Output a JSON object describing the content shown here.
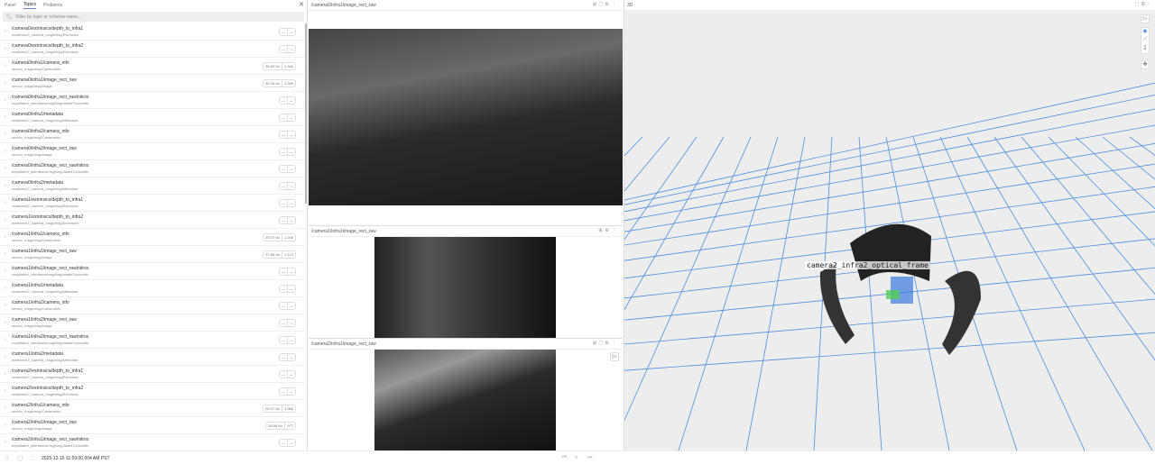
{
  "sidebar": {
    "tabs": [
      "Panel",
      "Topics",
      "Problems"
    ],
    "active_tab": "Topics",
    "search_placeholder": "Filter by topic or schema name...",
    "topics": [
      {
        "name": "/camera0/extrinsics/depth_to_infra1",
        "schema": "realsense2_camera_msgs/msg/Extrinsics",
        "hz": "—",
        "count": "—"
      },
      {
        "name": "/camera0/extrinsics/depth_to_infra2",
        "schema": "realsense2_camera_msgs/msg/Extrinsics",
        "hz": "—",
        "count": "—"
      },
      {
        "name": "/camera0/infra1/camera_info",
        "schema": "sensor_msgs/msg/CameraInfo",
        "hz": "38.89 Hz",
        "count": "1,346"
      },
      {
        "name": "/camera0/infra1/image_rect_raw",
        "schema": "sensor_msgs/msg/Image",
        "hz": "38.36 Hz",
        "count": "1,285"
      },
      {
        "name": "/camera0/infra1/image_rect_raw/nitros",
        "schema": "negotiated_interfaces/msg/NegotiatedTopicsInfo",
        "hz": "—",
        "count": "—"
      },
      {
        "name": "/camera0/infra1/metadata",
        "schema": "realsense2_camera_msgs/msg/Metadata",
        "hz": "—",
        "count": "—"
      },
      {
        "name": "/camera0/infra2/camera_info",
        "schema": "sensor_msgs/msg/CameraInfo",
        "hz": "—",
        "count": "—"
      },
      {
        "name": "/camera0/infra2/image_rect_raw",
        "schema": "sensor_msgs/msg/Image",
        "hz": "—",
        "count": "—"
      },
      {
        "name": "/camera0/infra2/image_rect_raw/nitros",
        "schema": "negotiated_interfaces/msg/NegotiatedTopicsInfo",
        "hz": "—",
        "count": "—"
      },
      {
        "name": "/camera0/infra2/metadata",
        "schema": "realsense2_camera_msgs/msg/Metadata",
        "hz": "—",
        "count": "—"
      },
      {
        "name": "/camera1/extrinsics/depth_to_infra1",
        "schema": "realsense2_camera_msgs/msg/Extrinsics",
        "hz": "—",
        "count": "—"
      },
      {
        "name": "/camera1/extrinsics/depth_to_infra2",
        "schema": "realsense2_camera_msgs/msg/Extrinsics",
        "hz": "—",
        "count": "—"
      },
      {
        "name": "/camera1/infra1/camera_info",
        "schema": "sensor_msgs/msg/CameraInfo",
        "hz": "29.07 Hz",
        "count": "1,205"
      },
      {
        "name": "/camera1/infra1/image_rect_raw",
        "schema": "sensor_msgs/msg/Image",
        "hz": "37.85 Hz",
        "count": "1,113"
      },
      {
        "name": "/camera1/infra1/image_rect_raw/nitros",
        "schema": "negotiated_interfaces/msg/NegotiatedTopicsInfo",
        "hz": "—",
        "count": "—"
      },
      {
        "name": "/camera1/infra1/metadata",
        "schema": "realsense2_camera_msgs/msg/Metadata",
        "hz": "—",
        "count": "—"
      },
      {
        "name": "/camera1/infra2/camera_info",
        "schema": "sensor_msgs/msg/CameraInfo",
        "hz": "—",
        "count": "—"
      },
      {
        "name": "/camera1/infra2/image_rect_raw",
        "schema": "sensor_msgs/msg/Image",
        "hz": "—",
        "count": "—"
      },
      {
        "name": "/camera1/infra2/image_rect_raw/nitros",
        "schema": "negotiated_interfaces/msg/NegotiatedTopicsInfo",
        "hz": "—",
        "count": "—"
      },
      {
        "name": "/camera1/infra2/metadata",
        "schema": "realsense2_camera_msgs/msg/Metadata",
        "hz": "—",
        "count": "—"
      },
      {
        "name": "/camera2/extrinsics/depth_to_infra1",
        "schema": "realsense2_camera_msgs/msg/Extrinsics",
        "hz": "—",
        "count": "—"
      },
      {
        "name": "/camera2/extrinsics/depth_to_infra2",
        "schema": "realsense2_camera_msgs/msg/Extrinsics",
        "hz": "—",
        "count": "—"
      },
      {
        "name": "/camera2/infra1/camera_info",
        "schema": "sensor_msgs/msg/CameraInfo",
        "hz": "28.97 Hz",
        "count": "1,068"
      },
      {
        "name": "/camera2/infra1/image_rect_raw",
        "schema": "sensor_msgs/msg/Image",
        "hz": "38.96 Hz",
        "count": "977"
      },
      {
        "name": "/camera2/infra1/image_rect_raw/nitros",
        "schema": "negotiated_interfaces/msg/NegotiatedTopicsInfo",
        "hz": "—",
        "count": "—"
      }
    ]
  },
  "panels": {
    "image1_title": "/camera0/infra1/image_rect_raw",
    "image2_title": "/camera1/infra1/image_rect_raw",
    "image3_title": "/camera2/infra1/image_rect_raw",
    "threed_title": "3D",
    "frame_label": "camera2_infra2_optical_frame"
  },
  "playback": {
    "timestamp": "2025-12-15 11:59:00.004 AM PST"
  },
  "colors": {
    "accent": "#6b7bd6",
    "grid": "#4a8fe0"
  }
}
